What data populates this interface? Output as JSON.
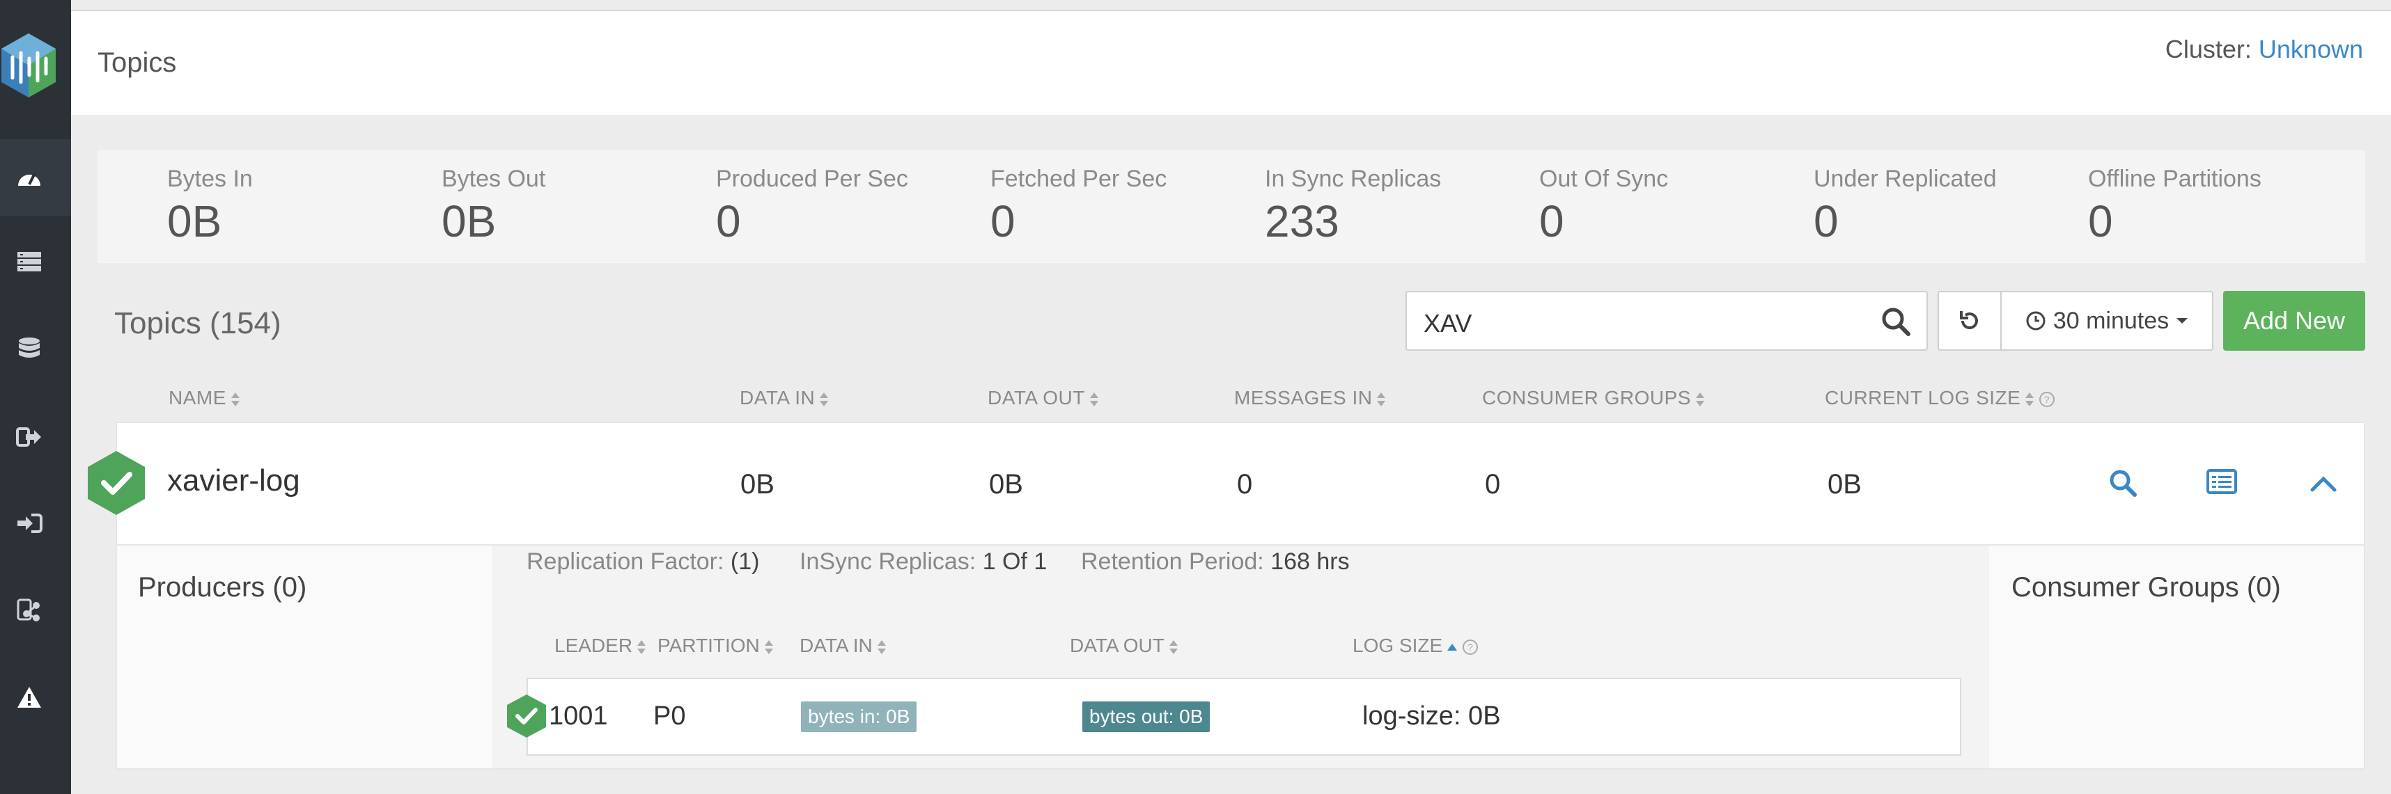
{
  "header": {
    "title": "Topics",
    "cluster_label": "Cluster: ",
    "cluster_value": "Unknown"
  },
  "sidebar": {
    "items": [
      {
        "icon": "dashboard-icon"
      },
      {
        "icon": "brokers-icon"
      },
      {
        "icon": "database-icon"
      },
      {
        "icon": "producers-icon"
      },
      {
        "icon": "consumers-icon"
      },
      {
        "icon": "topology-icon"
      },
      {
        "icon": "alert-icon"
      }
    ]
  },
  "stats": [
    {
      "label": "Bytes In",
      "value": "0B"
    },
    {
      "label": "Bytes Out",
      "value": "0B"
    },
    {
      "label": "Produced Per Sec",
      "value": "0"
    },
    {
      "label": "Fetched Per Sec",
      "value": "0"
    },
    {
      "label": "In Sync Replicas",
      "value": "233"
    },
    {
      "label": "Out Of Sync",
      "value": "0"
    },
    {
      "label": "Under Replicated",
      "value": "0"
    },
    {
      "label": "Offline Partitions",
      "value": "0"
    }
  ],
  "toolbar": {
    "topics_title": "Topics (154)",
    "search_value": "XAV",
    "time_range": "30 minutes",
    "add_new": "Add New"
  },
  "columns": [
    "NAME",
    "DATA IN",
    "DATA OUT",
    "MESSAGES IN",
    "CONSUMER GROUPS",
    "CURRENT LOG SIZE"
  ],
  "topic": {
    "name": "xavier-log",
    "data_in": "0B",
    "data_out": "0B",
    "messages_in": "0",
    "consumer_groups": "0",
    "log_size": "0B"
  },
  "detail": {
    "producers": "Producers (0)",
    "consumer_groups": "Consumer Groups (0)",
    "replication_label": "Replication Factor:",
    "replication_value": "(1)",
    "insync_label": "InSync Replicas:",
    "insync_value": "1 Of 1",
    "retention_label": "Retention Period:",
    "retention_value": "168 hrs",
    "columns": [
      "LEADER",
      "PARTITION",
      "DATA IN",
      "DATA OUT",
      "LOG SIZE"
    ],
    "partition": {
      "leader": "1001",
      "partition": "P0",
      "bytes_in": "bytes in: 0B",
      "bytes_out": "bytes out: 0B",
      "log_size": "log-size: 0B"
    }
  },
  "colors": {
    "accent": "#3a87c8",
    "success": "#5cb35c",
    "sidebar": "#2c3138"
  }
}
